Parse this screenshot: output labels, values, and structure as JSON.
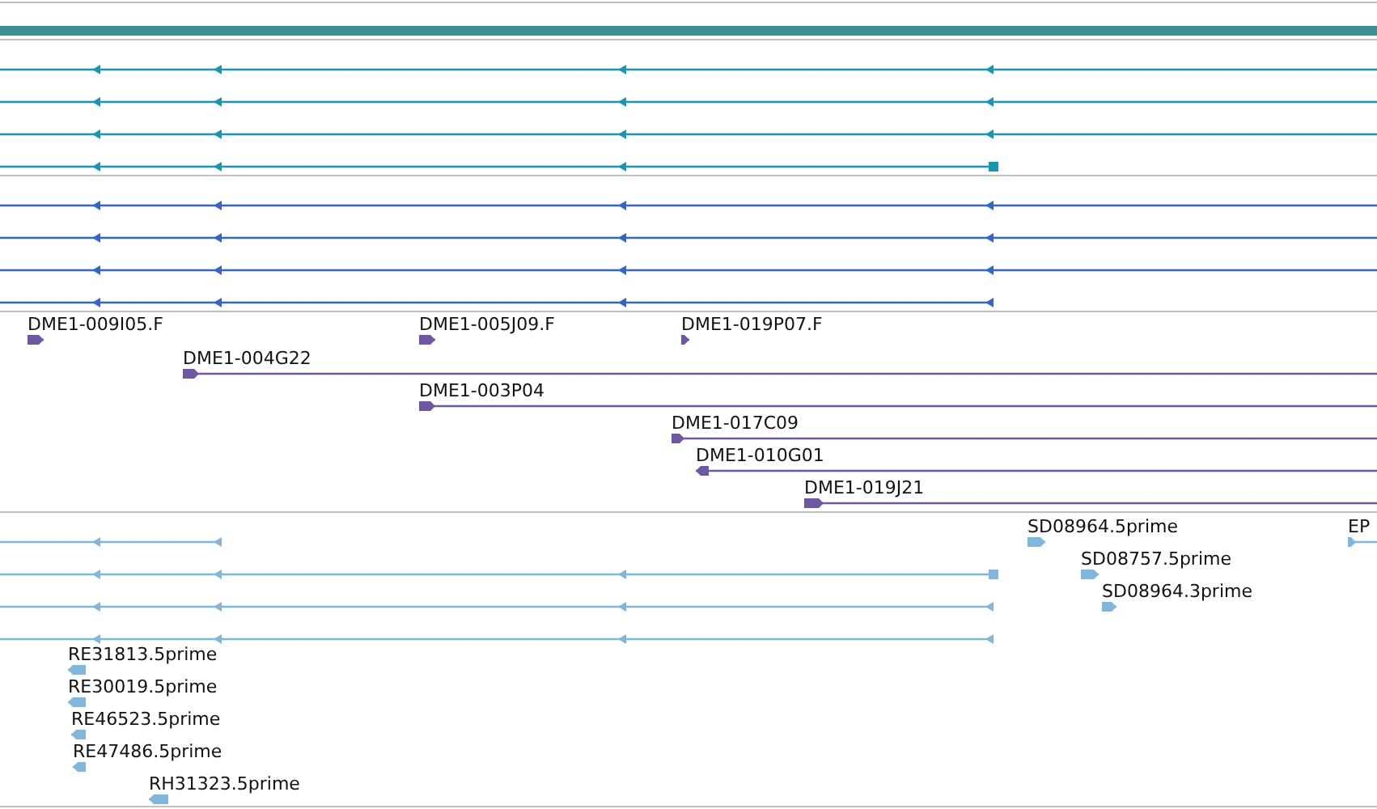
{
  "tracks": [
    {
      "kind": "span",
      "color": "#3d8f93"
    },
    {
      "kind": "features",
      "color": "#1497b5",
      "features": [
        {
          "reverse": true
        },
        {
          "reverse": true
        },
        {
          "reverse": true
        },
        {
          "reverse": true
        }
      ]
    },
    {
      "kind": "features",
      "color": "#3366cc",
      "features": [
        {
          "reverse": true
        },
        {
          "reverse": true
        },
        {
          "reverse": true
        },
        {
          "reverse": true
        }
      ]
    },
    {
      "kind": "features",
      "color": "#7057a3",
      "features": [
        {
          "label": "DME1-009I05.F",
          "reverse": false
        },
        {
          "label": "DME1-005J09.F",
          "reverse": false
        },
        {
          "label": "DME1-019P07.F",
          "reverse": false
        },
        {
          "label": "DME1-004G22",
          "reverse": false
        },
        {
          "label": "DME1-003P04",
          "reverse": false
        },
        {
          "label": "DME1-017C09",
          "reverse": false
        },
        {
          "label": "DME1-010G01",
          "reverse": true
        },
        {
          "label": "DME1-019J21",
          "reverse": false
        }
      ]
    },
    {
      "kind": "features",
      "color": "#7fb6dc",
      "features": [
        {
          "reverse": true
        },
        {
          "label": "SD08964.5prime",
          "reverse": false
        },
        {
          "label": "EP",
          "reverse": false
        },
        {
          "reverse": true
        },
        {
          "label": "SD08757.5prime",
          "reverse": false
        },
        {
          "reverse": true
        },
        {
          "label": "SD08964.3prime",
          "reverse": false
        },
        {
          "reverse": true
        },
        {
          "label": "RE31813.5prime",
          "reverse": true
        },
        {
          "label": "RE30019.5prime",
          "reverse": true
        },
        {
          "label": "RE46523.5prime",
          "reverse": true
        },
        {
          "label": "RE47486.5prime",
          "reverse": true
        },
        {
          "label": "RH31323.5prime",
          "reverse": true
        }
      ]
    }
  ]
}
